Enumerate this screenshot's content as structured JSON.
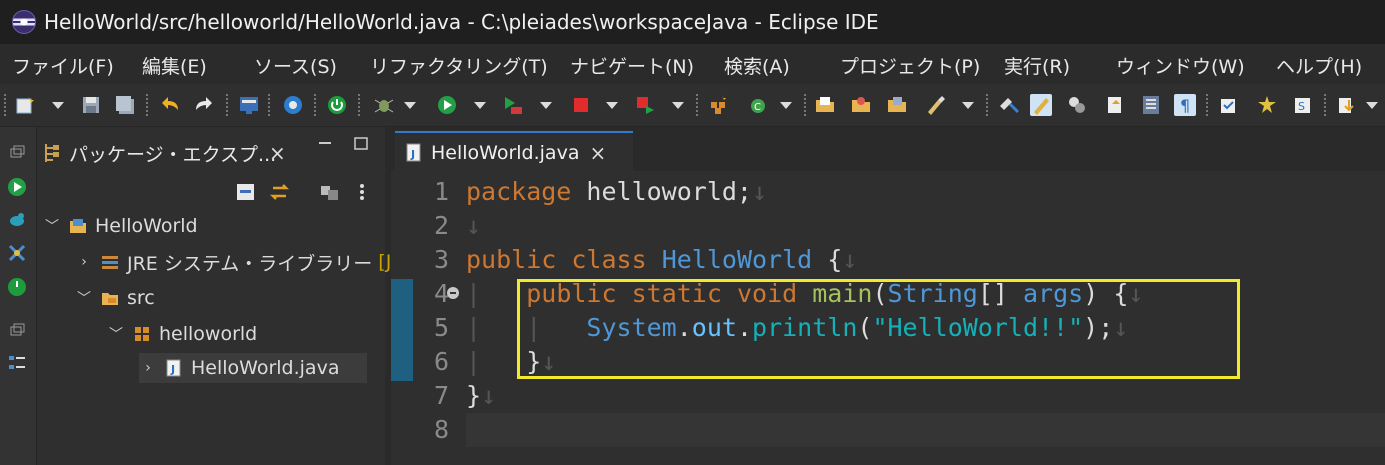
{
  "window": {
    "title": "HelloWorld/src/helloworld/HelloWorld.java - C:\\pleiades\\workspaceJava - Eclipse IDE"
  },
  "menu": [
    "ファイル(F)",
    "編集(E)",
    "ソース(S)",
    "リファクタリング(T)",
    "ナビゲート(N)",
    "検索(A)",
    "プロジェクト(P)",
    "実行(R)",
    "ウィンドウ(W)",
    "ヘルプ(H)"
  ],
  "toolbar_icons": [
    "new-icon",
    "save-icon",
    "save-all-icon",
    "undo-icon",
    "redo-icon",
    "console-icon",
    "settings-icon",
    "run-power-icon",
    "debug-bug-icon",
    "run-icon",
    "run-server-icon",
    "stop-icon",
    "terminate-icon",
    "new-package-icon",
    "refresh-icon",
    "open-type-icon",
    "open-folder-icon",
    "open-resource-icon",
    "brush-icon",
    "search-icon",
    "highlight-icon",
    "toggle-icon",
    "mark-icon",
    "format-icon",
    "pilcrow-icon",
    "task-icon",
    "build-icon",
    "save-step-icon",
    "download-icon"
  ],
  "left_trim_icons": [
    "minimize-icon",
    "run-icon",
    "debug-icon",
    "cross-icon",
    "power-icon",
    "minimize-icon",
    "outline-icon"
  ],
  "package_explorer": {
    "tab_label": "パッケージ・エクスプ...",
    "close": "×",
    "tree": [
      {
        "label": "HelloWorld",
        "icon": "project-icon",
        "expanded": true,
        "level": 0
      },
      {
        "label": "JRE システム・ライブラリー",
        "decoration": "[J",
        "icon": "library-icon",
        "expanded": false,
        "level": 1
      },
      {
        "label": "src",
        "icon": "source-folder-icon",
        "expanded": true,
        "level": 1
      },
      {
        "label": "helloworld",
        "icon": "package-icon",
        "expanded": true,
        "level": 2
      },
      {
        "label": "HelloWorld.java",
        "icon": "java-file-icon",
        "expanded": false,
        "level": 3,
        "selected": true
      }
    ]
  },
  "editor": {
    "tab_label": "HelloWorld.java",
    "close": "×",
    "line_numbers": [
      "1",
      "2",
      "3",
      "4",
      "5",
      "6",
      "7",
      "8"
    ],
    "code": {
      "l1_kw": "package",
      "l1_rest": " helloworld;",
      "l3_kw1": "public",
      "l3_kw2": "class",
      "l3_type": "HelloWorld",
      "l3_rest": " {",
      "l4_kw1": "public",
      "l4_kw2": "static",
      "l4_kw3": "void",
      "l4_fn": "main",
      "l4_p1": "(",
      "l4_type": "String",
      "l4_p2": "[] ",
      "l4_arg": "args",
      "l4_p3": ") {",
      "l5_type": "System",
      "l5_dot": ".",
      "l5_field": "out",
      "l5_dot2": ".",
      "l5_method": "println",
      "l5_p1": "(",
      "l5_str": "\"HelloWorld!!\"",
      "l5_p2": ");",
      "l6": "}",
      "l7": "}",
      "nl": "↓"
    }
  },
  "colors": {
    "keyword": "#cc7832",
    "type": "#4f97d6",
    "method": "#a5c25c",
    "string": "#15b0b8",
    "highlight_box": "#f1ea2a"
  }
}
